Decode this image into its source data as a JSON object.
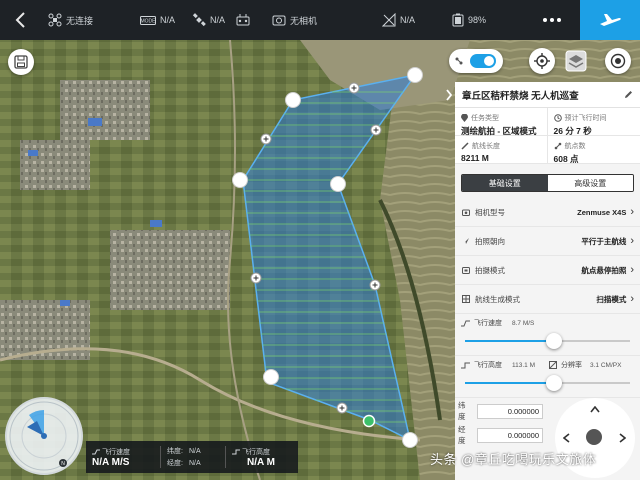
{
  "topbar": {
    "connection": "无连接",
    "mode": "N/A",
    "gps": "N/A",
    "rc": "",
    "camera": "无相机",
    "signal": "N/A",
    "battery": "98%",
    "more_icon": "ellipsis-icon",
    "fly_icon": "airplane-icon"
  },
  "map": {
    "colors": {
      "area_fill": "#2e7bd6",
      "area_stroke": "#5ab0f0",
      "flight_line": "#7dd86a",
      "vertex": "#ffffff",
      "start_point": "#3cc06a"
    }
  },
  "panel": {
    "title": "章丘区秸秆禁烧 无人机巡查",
    "edit_icon": "pencil-icon",
    "mission_type_label": "任务类型",
    "mission_type_value": "测绘航拍 - 区域模式",
    "flight_time_label": "预计飞行时间",
    "flight_time_value": "26 分 7 秒",
    "route_length_label": "航线长度",
    "route_length_value": "8211 M",
    "waypoints_label": "航点数",
    "waypoints_value": "608 点",
    "tab_basic": "基础设置",
    "tab_advanced": "高级设置",
    "rows": [
      {
        "label": "相机型号",
        "value": "Zenmuse X4S"
      },
      {
        "label": "拍照朝向",
        "value": "平行于主航线"
      },
      {
        "label": "拍摄模式",
        "value": "航点悬停拍照"
      },
      {
        "label": "航线生成模式",
        "value": "扫描模式"
      }
    ],
    "speed_label": "飞行速度",
    "speed_value": "8.7 M/S",
    "speed_fraction": 0.54,
    "altitude_label": "飞行高度",
    "altitude_value": "113.1 M",
    "resolution_label": "分辨率",
    "resolution_value": "3.1 CM/PX",
    "altitude_fraction": 0.54,
    "latitude_label": "纬度",
    "latitude_value": "0.000000",
    "longitude_label": "经度",
    "longitude_value": "0.000000"
  },
  "telemetry": {
    "speed_label": "飞行速度",
    "speed_value": "N/A M/S",
    "lat_label": "纬度:",
    "lat_value": "N/A",
    "lon_label": "经度:",
    "lon_value": "N/A",
    "alt_label": "飞行高度",
    "alt_value": "N/A M"
  },
  "watermark": "头条 @章丘吃喝玩乐文旅体"
}
